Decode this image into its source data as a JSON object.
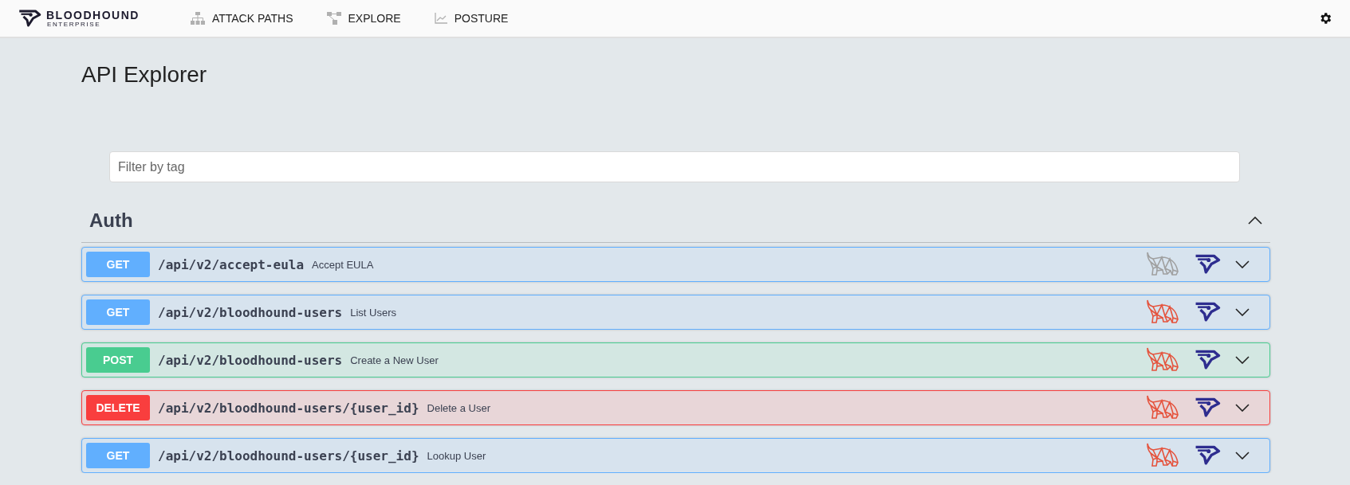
{
  "header": {
    "logo": {
      "name": "BLOODHOUND",
      "subtitle": "ENTERPRISE"
    },
    "nav": [
      {
        "label": "ATTACK PATHS",
        "kind": "tree"
      },
      {
        "label": "EXPLORE",
        "kind": "graph"
      },
      {
        "label": "POSTURE",
        "kind": "trend"
      }
    ]
  },
  "page": {
    "title": "API Explorer"
  },
  "filter": {
    "placeholder": "Filter by tag"
  },
  "sections": [
    {
      "title": "Auth",
      "expanded": true,
      "operations": [
        {
          "method": "GET",
          "path": "/api/v2/accept-eula",
          "summary": "Accept EULA",
          "color": "#a0a0a0",
          "expanded": false
        },
        {
          "method": "GET",
          "path": "/api/v2/bloodhound-users",
          "summary": "List Users",
          "color": "#e5533d",
          "expanded": false
        },
        {
          "method": "POST",
          "path": "/api/v2/bloodhound-users",
          "summary": "Create a New User",
          "color": "#e5533d",
          "expanded": false
        },
        {
          "method": "DELETE",
          "path": "/api/v2/bloodhound-users/{user_id}",
          "summary": "Delete a User",
          "color": "#e5533d",
          "expanded": false
        },
        {
          "method": "GET",
          "path": "/api/v2/bloodhound-users/{user_id}",
          "summary": "Lookup User",
          "color": "#e5533d",
          "expanded": false
        }
      ]
    }
  ]
}
